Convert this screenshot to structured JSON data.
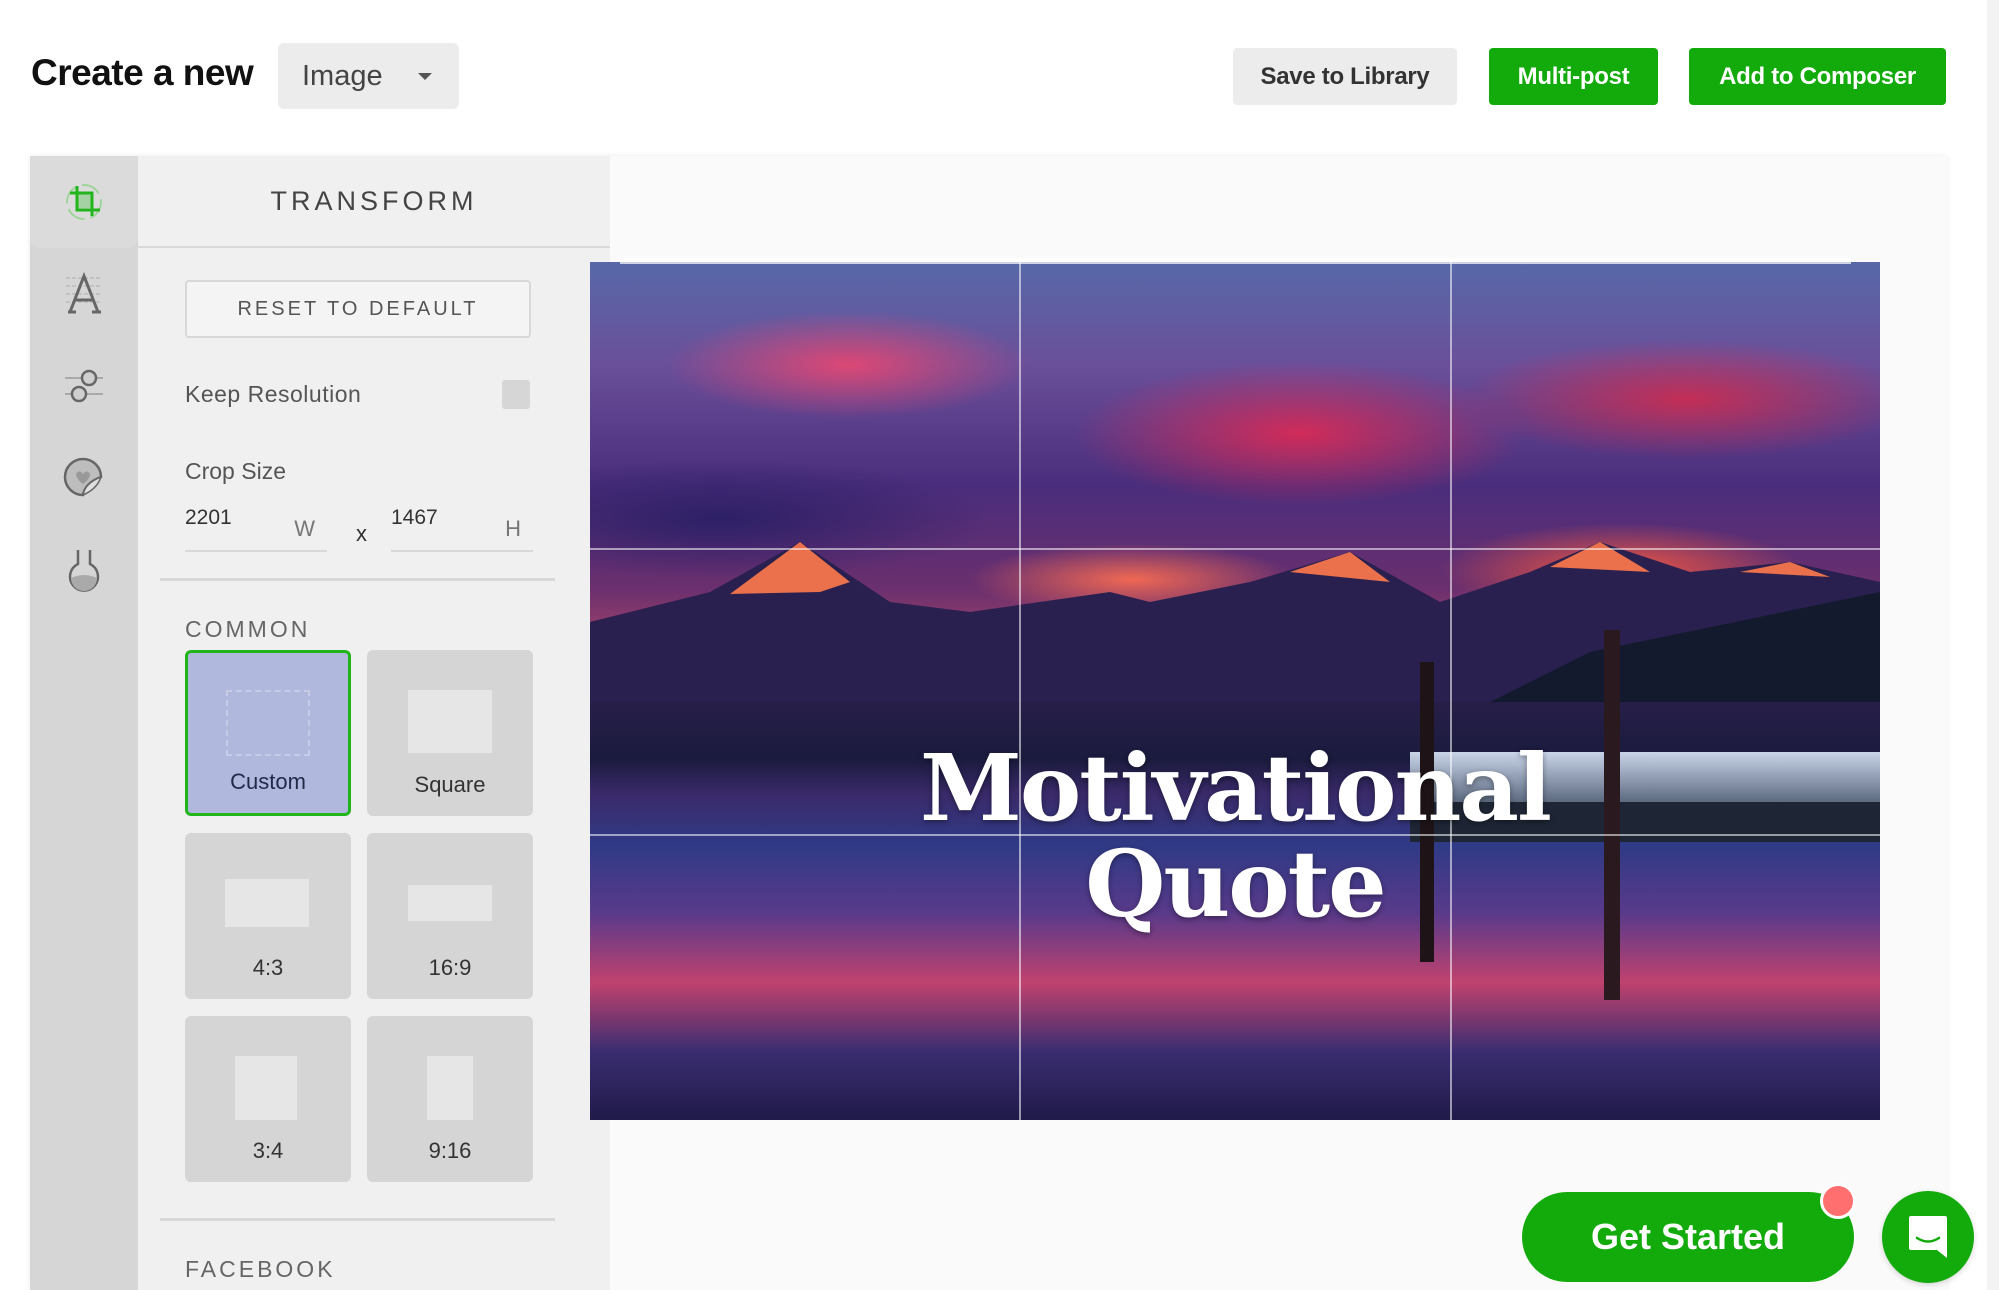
{
  "header": {
    "title": "Create a new",
    "type_select": {
      "selected": "Image"
    },
    "buttons": {
      "save_to_library": "Save to Library",
      "multi_post": "Multi-post",
      "add_to_composer": "Add to Composer"
    }
  },
  "colors": {
    "accent_green": "#13ab0b",
    "selected_preset": "#b0b8de",
    "notification": "#ff6f6f"
  },
  "sidebar": {
    "tools": [
      {
        "name": "transform",
        "icon": "crop-icon",
        "active": true
      },
      {
        "name": "text",
        "icon": "text-icon",
        "active": false
      },
      {
        "name": "adjust",
        "icon": "sliders-icon",
        "active": false
      },
      {
        "name": "stickers",
        "icon": "sticker-icon",
        "active": false
      },
      {
        "name": "filters",
        "icon": "flask-icon",
        "active": false
      }
    ]
  },
  "panel": {
    "title": "TRANSFORM",
    "reset_label": "RESET TO DEFAULT",
    "keep_resolution_label": "Keep Resolution",
    "keep_resolution_checked": false,
    "crop_size_label": "Crop Size",
    "width_value": "2201",
    "width_unit": "W",
    "separator": "x",
    "height_value": "1467",
    "height_unit": "H",
    "sections": [
      {
        "label": "COMMON",
        "presets": [
          {
            "label": "Custom",
            "selected": true
          },
          {
            "label": "Square",
            "selected": false
          },
          {
            "label": "4:3",
            "selected": false
          },
          {
            "label": "16:9",
            "selected": false
          },
          {
            "label": "3:4",
            "selected": false
          },
          {
            "label": "9:16",
            "selected": false
          }
        ]
      },
      {
        "label": "FACEBOOK",
        "presets": []
      }
    ]
  },
  "canvas": {
    "quote_line1": "Motivational",
    "quote_line2": "Quote"
  },
  "floating": {
    "get_started": "Get Started",
    "chat_icon": "chat-icon"
  }
}
